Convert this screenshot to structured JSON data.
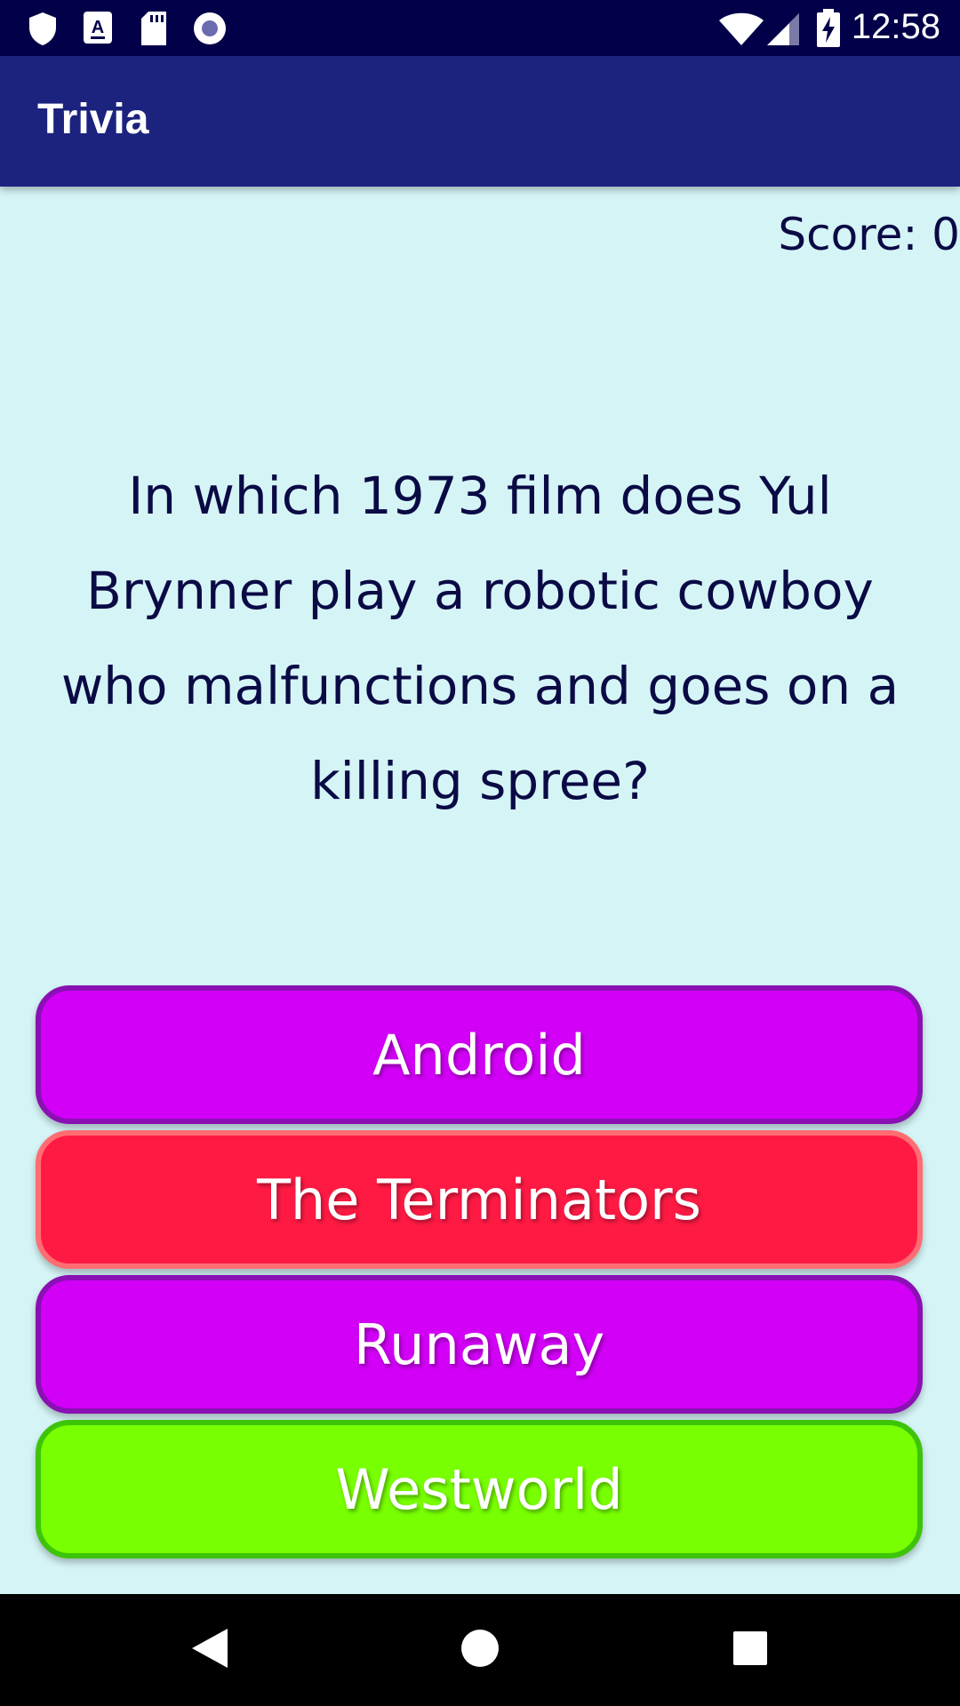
{
  "status_bar": {
    "time": "12:58",
    "left_icons": [
      "shield-icon",
      "a-notification-icon",
      "sd-card-icon",
      "record-icon"
    ],
    "right_icons": [
      "wifi-icon",
      "signal-icon",
      "battery-charging-icon"
    ]
  },
  "app_bar": {
    "title": "Trivia"
  },
  "score": {
    "text": "Score: 0"
  },
  "question": {
    "text": "In which 1973 film does Yul Brynner play a robotic cowboy who malfunctions and goes on a killing spree?"
  },
  "answers": [
    {
      "label": "Android",
      "state": "neutral"
    },
    {
      "label": "The Terminators",
      "state": "wrong"
    },
    {
      "label": "Runaway",
      "state": "neutral"
    },
    {
      "label": "Westworld",
      "state": "correct"
    }
  ],
  "nav_bar": {
    "icons": [
      "back-icon",
      "home-icon",
      "recents-icon"
    ]
  },
  "colors": {
    "status_bar": "#020049",
    "app_bar": "#1b237e",
    "background": "#d5f4f6",
    "neutral": "#d200f7",
    "wrong": "#ff1a44",
    "correct": "#78ff02"
  }
}
